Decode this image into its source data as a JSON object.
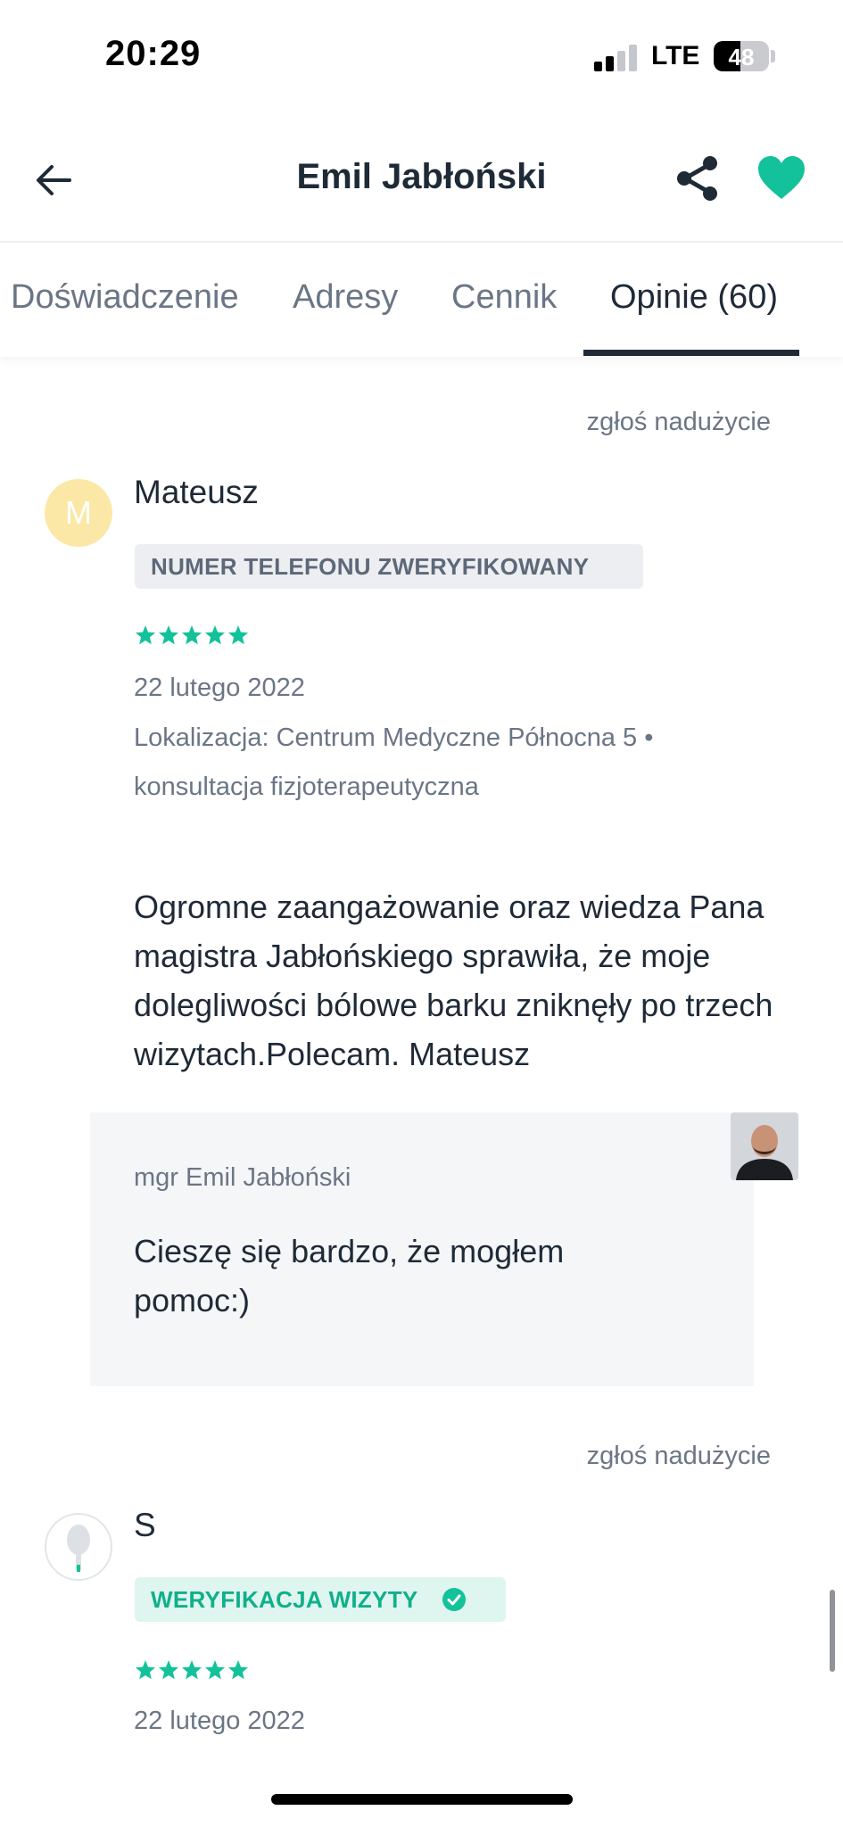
{
  "status_bar": {
    "time": "20:29",
    "network": "LTE",
    "battery": "48",
    "battery_level": 0.48
  },
  "header": {
    "title": "Emil Jabłoński"
  },
  "tabs": [
    {
      "label": "Doświadczenie"
    },
    {
      "label": "Adresy"
    },
    {
      "label": "Cennik"
    },
    {
      "label": "Opinie (60)",
      "active": true
    }
  ],
  "reviews": [
    {
      "report_label": "zgłoś nadużycie",
      "avatar_initial": "M",
      "author": "Mateusz",
      "badge": "NUMER TELEFONU ZWERYFIKOWANY",
      "rating": 5,
      "date": "22 lutego 2022",
      "location_line1": "Lokalizacja: Centrum Medyczne Północna 5 •",
      "location_line2": "konsultacja fizjoterapeutyczna",
      "text": "Ogromne zaangażowanie oraz wiedza Pana magistra Jabłońskiego sprawiła, że moje dolegliwości bólowe barku zniknęły po trzech wizytach.Polecam. Mateusz",
      "reply": {
        "author": "mgr Emil Jabłoński",
        "text": "Cieszę się bardzo, że mogłem pomoc:)"
      }
    },
    {
      "report_label": "zgłoś nadużycie",
      "author": "S",
      "badge": "WERYFIKACJA WIZYTY",
      "rating": 5,
      "date": "22 lutego 2022"
    }
  ],
  "colors": {
    "accent": "#13c29a",
    "text_dark": "#1f2a37",
    "text_muted": "#6b7685"
  }
}
